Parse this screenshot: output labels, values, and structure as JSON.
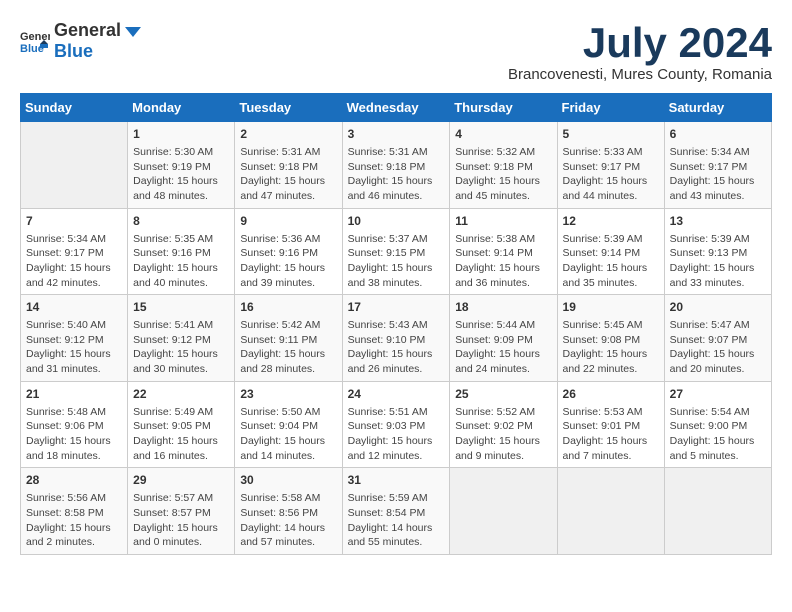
{
  "logo": {
    "general": "General",
    "blue": "Blue"
  },
  "title": "July 2024",
  "subtitle": "Brancovenesti, Mures County, Romania",
  "days_of_week": [
    "Sunday",
    "Monday",
    "Tuesday",
    "Wednesday",
    "Thursday",
    "Friday",
    "Saturday"
  ],
  "weeks": [
    [
      {
        "day": "",
        "sunrise": "",
        "sunset": "",
        "daylight": "",
        "empty": true
      },
      {
        "day": "1",
        "sunrise": "Sunrise: 5:30 AM",
        "sunset": "Sunset: 9:19 PM",
        "daylight": "Daylight: 15 hours and 48 minutes.",
        "empty": false
      },
      {
        "day": "2",
        "sunrise": "Sunrise: 5:31 AM",
        "sunset": "Sunset: 9:18 PM",
        "daylight": "Daylight: 15 hours and 47 minutes.",
        "empty": false
      },
      {
        "day": "3",
        "sunrise": "Sunrise: 5:31 AM",
        "sunset": "Sunset: 9:18 PM",
        "daylight": "Daylight: 15 hours and 46 minutes.",
        "empty": false
      },
      {
        "day": "4",
        "sunrise": "Sunrise: 5:32 AM",
        "sunset": "Sunset: 9:18 PM",
        "daylight": "Daylight: 15 hours and 45 minutes.",
        "empty": false
      },
      {
        "day": "5",
        "sunrise": "Sunrise: 5:33 AM",
        "sunset": "Sunset: 9:17 PM",
        "daylight": "Daylight: 15 hours and 44 minutes.",
        "empty": false
      },
      {
        "day": "6",
        "sunrise": "Sunrise: 5:34 AM",
        "sunset": "Sunset: 9:17 PM",
        "daylight": "Daylight: 15 hours and 43 minutes.",
        "empty": false
      }
    ],
    [
      {
        "day": "7",
        "sunrise": "Sunrise: 5:34 AM",
        "sunset": "Sunset: 9:17 PM",
        "daylight": "Daylight: 15 hours and 42 minutes.",
        "empty": false
      },
      {
        "day": "8",
        "sunrise": "Sunrise: 5:35 AM",
        "sunset": "Sunset: 9:16 PM",
        "daylight": "Daylight: 15 hours and 40 minutes.",
        "empty": false
      },
      {
        "day": "9",
        "sunrise": "Sunrise: 5:36 AM",
        "sunset": "Sunset: 9:16 PM",
        "daylight": "Daylight: 15 hours and 39 minutes.",
        "empty": false
      },
      {
        "day": "10",
        "sunrise": "Sunrise: 5:37 AM",
        "sunset": "Sunset: 9:15 PM",
        "daylight": "Daylight: 15 hours and 38 minutes.",
        "empty": false
      },
      {
        "day": "11",
        "sunrise": "Sunrise: 5:38 AM",
        "sunset": "Sunset: 9:14 PM",
        "daylight": "Daylight: 15 hours and 36 minutes.",
        "empty": false
      },
      {
        "day": "12",
        "sunrise": "Sunrise: 5:39 AM",
        "sunset": "Sunset: 9:14 PM",
        "daylight": "Daylight: 15 hours and 35 minutes.",
        "empty": false
      },
      {
        "day": "13",
        "sunrise": "Sunrise: 5:39 AM",
        "sunset": "Sunset: 9:13 PM",
        "daylight": "Daylight: 15 hours and 33 minutes.",
        "empty": false
      }
    ],
    [
      {
        "day": "14",
        "sunrise": "Sunrise: 5:40 AM",
        "sunset": "Sunset: 9:12 PM",
        "daylight": "Daylight: 15 hours and 31 minutes.",
        "empty": false
      },
      {
        "day": "15",
        "sunrise": "Sunrise: 5:41 AM",
        "sunset": "Sunset: 9:12 PM",
        "daylight": "Daylight: 15 hours and 30 minutes.",
        "empty": false
      },
      {
        "day": "16",
        "sunrise": "Sunrise: 5:42 AM",
        "sunset": "Sunset: 9:11 PM",
        "daylight": "Daylight: 15 hours and 28 minutes.",
        "empty": false
      },
      {
        "day": "17",
        "sunrise": "Sunrise: 5:43 AM",
        "sunset": "Sunset: 9:10 PM",
        "daylight": "Daylight: 15 hours and 26 minutes.",
        "empty": false
      },
      {
        "day": "18",
        "sunrise": "Sunrise: 5:44 AM",
        "sunset": "Sunset: 9:09 PM",
        "daylight": "Daylight: 15 hours and 24 minutes.",
        "empty": false
      },
      {
        "day": "19",
        "sunrise": "Sunrise: 5:45 AM",
        "sunset": "Sunset: 9:08 PM",
        "daylight": "Daylight: 15 hours and 22 minutes.",
        "empty": false
      },
      {
        "day": "20",
        "sunrise": "Sunrise: 5:47 AM",
        "sunset": "Sunset: 9:07 PM",
        "daylight": "Daylight: 15 hours and 20 minutes.",
        "empty": false
      }
    ],
    [
      {
        "day": "21",
        "sunrise": "Sunrise: 5:48 AM",
        "sunset": "Sunset: 9:06 PM",
        "daylight": "Daylight: 15 hours and 18 minutes.",
        "empty": false
      },
      {
        "day": "22",
        "sunrise": "Sunrise: 5:49 AM",
        "sunset": "Sunset: 9:05 PM",
        "daylight": "Daylight: 15 hours and 16 minutes.",
        "empty": false
      },
      {
        "day": "23",
        "sunrise": "Sunrise: 5:50 AM",
        "sunset": "Sunset: 9:04 PM",
        "daylight": "Daylight: 15 hours and 14 minutes.",
        "empty": false
      },
      {
        "day": "24",
        "sunrise": "Sunrise: 5:51 AM",
        "sunset": "Sunset: 9:03 PM",
        "daylight": "Daylight: 15 hours and 12 minutes.",
        "empty": false
      },
      {
        "day": "25",
        "sunrise": "Sunrise: 5:52 AM",
        "sunset": "Sunset: 9:02 PM",
        "daylight": "Daylight: 15 hours and 9 minutes.",
        "empty": false
      },
      {
        "day": "26",
        "sunrise": "Sunrise: 5:53 AM",
        "sunset": "Sunset: 9:01 PM",
        "daylight": "Daylight: 15 hours and 7 minutes.",
        "empty": false
      },
      {
        "day": "27",
        "sunrise": "Sunrise: 5:54 AM",
        "sunset": "Sunset: 9:00 PM",
        "daylight": "Daylight: 15 hours and 5 minutes.",
        "empty": false
      }
    ],
    [
      {
        "day": "28",
        "sunrise": "Sunrise: 5:56 AM",
        "sunset": "Sunset: 8:58 PM",
        "daylight": "Daylight: 15 hours and 2 minutes.",
        "empty": false
      },
      {
        "day": "29",
        "sunrise": "Sunrise: 5:57 AM",
        "sunset": "Sunset: 8:57 PM",
        "daylight": "Daylight: 15 hours and 0 minutes.",
        "empty": false
      },
      {
        "day": "30",
        "sunrise": "Sunrise: 5:58 AM",
        "sunset": "Sunset: 8:56 PM",
        "daylight": "Daylight: 14 hours and 57 minutes.",
        "empty": false
      },
      {
        "day": "31",
        "sunrise": "Sunrise: 5:59 AM",
        "sunset": "Sunset: 8:54 PM",
        "daylight": "Daylight: 14 hours and 55 minutes.",
        "empty": false
      },
      {
        "day": "",
        "sunrise": "",
        "sunset": "",
        "daylight": "",
        "empty": true
      },
      {
        "day": "",
        "sunrise": "",
        "sunset": "",
        "daylight": "",
        "empty": true
      },
      {
        "day": "",
        "sunrise": "",
        "sunset": "",
        "daylight": "",
        "empty": true
      }
    ]
  ]
}
